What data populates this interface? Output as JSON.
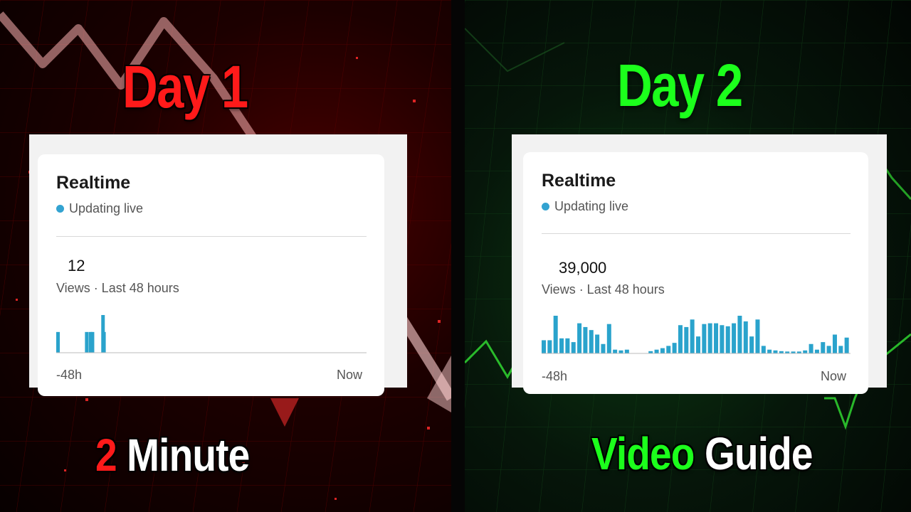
{
  "left": {
    "headline": "Day 1",
    "headline_color": "#ff1a1a",
    "card": {
      "title": "Realtime",
      "status": "Updating live",
      "metric_value": "12",
      "metric_label": "Views · Last 48 hours",
      "axis_start": "-48h",
      "axis_end": "Now",
      "bars": [
        0.55,
        0,
        0,
        0,
        0,
        0,
        0,
        0,
        0,
        0,
        0,
        0,
        0,
        0,
        0,
        0,
        0,
        0,
        0,
        0,
        0,
        0,
        0,
        0,
        0,
        0,
        0,
        0,
        0,
        0,
        0.55,
        0,
        0,
        0,
        0.55,
        0,
        0.55,
        0,
        0,
        0,
        0,
        0,
        0,
        0,
        0,
        0,
        0,
        1.0,
        0.55,
        0,
        0,
        0,
        0,
        0,
        0,
        0,
        0,
        0,
        0,
        0,
        0,
        0,
        0,
        0,
        0,
        0,
        0,
        0,
        0,
        0,
        0,
        0,
        0,
        0,
        0,
        0,
        0,
        0,
        0,
        0,
        0,
        0,
        0,
        0,
        0,
        0,
        0,
        0,
        0,
        0,
        0,
        0,
        0,
        0,
        0,
        0,
        0,
        0,
        0,
        0,
        0,
        0,
        0,
        0,
        0,
        0,
        0,
        0,
        0,
        0,
        0,
        0,
        0,
        0,
        0,
        0,
        0,
        0,
        0,
        0,
        0,
        0,
        0,
        0,
        0,
        0,
        0,
        0,
        0,
        0,
        0,
        0,
        0,
        0,
        0,
        0,
        0,
        0,
        0,
        0,
        0,
        0,
        0,
        0,
        0,
        0,
        0,
        0,
        0,
        0,
        0,
        0,
        0,
        0,
        0,
        0,
        0,
        0,
        0,
        0,
        0,
        0,
        0,
        0,
        0,
        0,
        0,
        0,
        0,
        0,
        0,
        0,
        0,
        0,
        0,
        0,
        0,
        0,
        0,
        0,
        0,
        0,
        0,
        0,
        0,
        0,
        0,
        0,
        0,
        0,
        0,
        0,
        0,
        0,
        0,
        0,
        0,
        0,
        0,
        0,
        0,
        0,
        0,
        0,
        0,
        0,
        0,
        0,
        0,
        0,
        0,
        0,
        0,
        0,
        0,
        0,
        0,
        0,
        0,
        0,
        0,
        0,
        0,
        0,
        0,
        0,
        0,
        0,
        0,
        0,
        0,
        0,
        0,
        0,
        0,
        0,
        0,
        0,
        0,
        0,
        0,
        0,
        0,
        0,
        0,
        0,
        0,
        0,
        0,
        0,
        0,
        0,
        0,
        0,
        0,
        0,
        0,
        0,
        0,
        0,
        0,
        0,
        0,
        0,
        0,
        0,
        0,
        0,
        0,
        0,
        0,
        0,
        0,
        0,
        0,
        0,
        0,
        0,
        0,
        0,
        0,
        0,
        0,
        0,
        0,
        0,
        0,
        0,
        0,
        0,
        0,
        0,
        0,
        0,
        0,
        0,
        0,
        0,
        0,
        0,
        0,
        0,
        0,
        0,
        0,
        0,
        0,
        0,
        0,
        0,
        0,
        0,
        0,
        0,
        0,
        0,
        0,
        0,
        0,
        0,
        0,
        0,
        0,
        0
      ]
    },
    "caption": {
      "number": "2",
      "number_color": "#ff1a1a",
      "word": "Minute",
      "word_color": "#ffffff"
    }
  },
  "right": {
    "headline": "Day 2",
    "headline_color": "#1cff1c",
    "card": {
      "title": "Realtime",
      "status": "Updating live",
      "metric_value": "39,000",
      "metric_label": "Views · Last 48 hours",
      "axis_start": "-48h",
      "axis_end": "Now",
      "bars": [
        0.35,
        0.35,
        1.0,
        0.4,
        0.4,
        0.3,
        0.8,
        0.7,
        0.62,
        0.5,
        0.25,
        0.78,
        0.1,
        0.08,
        0.1,
        0,
        0,
        0,
        0.06,
        0.1,
        0.14,
        0.2,
        0.28,
        0.75,
        0.7,
        0.9,
        0.45,
        0.78,
        0.8,
        0.8,
        0.75,
        0.72,
        0.8,
        1.0,
        0.85,
        0.45,
        0.9,
        0.2,
        0.1,
        0.08,
        0.06,
        0.05,
        0.05,
        0.05,
        0.08,
        0.25,
        0.1,
        0.3,
        0.2,
        0.5,
        0.2,
        0.42
      ]
    },
    "caption": {
      "word1": "Video",
      "word1_color": "#1cff1c",
      "word2": "Guide",
      "word2_color": "#ffffff"
    }
  },
  "accent_bar_color": "#2aa3cc"
}
